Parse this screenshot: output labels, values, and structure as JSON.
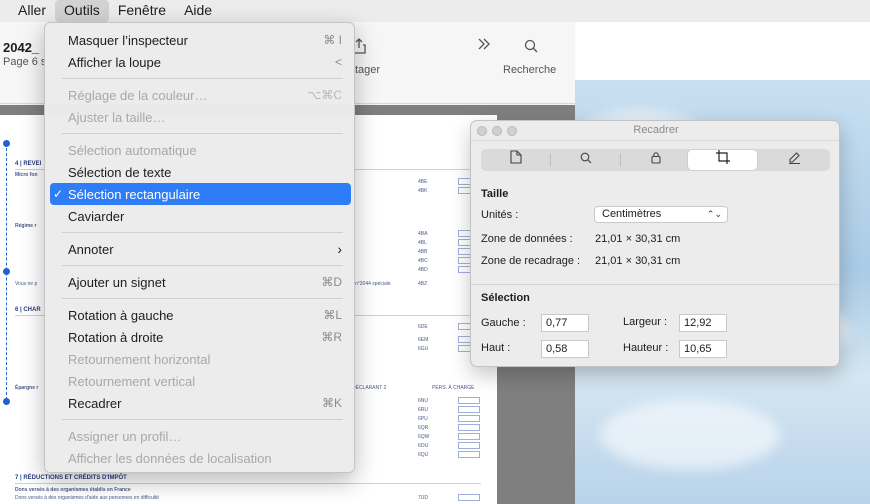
{
  "menubar": {
    "items": [
      "Aller",
      "Outils",
      "Fenêtre",
      "Aide"
    ],
    "active_index": 1
  },
  "preview": {
    "doc_title": "2042_",
    "doc_subtitle": "Page 6 s",
    "toolbar": {
      "share_label": "tager",
      "search_label": "Recherche"
    },
    "page_text": {
      "h4": "4 | REVEI",
      "h6": "6 | CHAR",
      "h7": "7 | RÉDUCTIONS ET CRÉDITS D'IMPÔT",
      "micro": "Micro fon",
      "regime": "Régime r",
      "epargne": "Épargne r",
      "dons1": "Dons versés à des organismes établis en France",
      "dons2": "Dons versés à des organismes d'aide aux personnes en difficulté",
      "vous_ne": "Vous ne p",
      "spec": "n°2044 spéciale",
      "codes": [
        "4BE",
        "4BK",
        "4BA",
        "4BL",
        "4BB",
        "4BC",
        "4BD",
        "4BZ",
        "6DE",
        "6EM",
        "6GU",
        "6NU",
        "6RU",
        "6PU",
        "6QR",
        "6QW",
        "6OU",
        "6QU",
        "7UD"
      ],
      "declarant": "DÉCLARANT 2",
      "pers": "PERS. À CHARGE"
    }
  },
  "menu": {
    "items": [
      {
        "label": "Masquer l’inspecteur",
        "shortcut": "⌘ I",
        "enabled": true
      },
      {
        "label": "Afficher la loupe",
        "shortcut": "<",
        "enabled": true
      },
      {
        "label": "Réglage de la couleur…",
        "shortcut": "⌥⌘C",
        "enabled": false
      },
      {
        "label": "Ajuster la taille…",
        "shortcut": "",
        "enabled": false
      },
      {
        "label": "Sélection automatique",
        "shortcut": "",
        "enabled": false
      },
      {
        "label": "Sélection de texte",
        "shortcut": "",
        "enabled": true
      },
      {
        "label": "Sélection rectangulaire",
        "shortcut": "",
        "enabled": true,
        "checked": true,
        "highlighted": true
      },
      {
        "label": "Caviarder",
        "shortcut": "",
        "enabled": true
      },
      {
        "label": "Annoter",
        "shortcut": "",
        "enabled": true,
        "submenu": true
      },
      {
        "label": "Ajouter un signet",
        "shortcut": "⌘D",
        "enabled": true
      },
      {
        "label": "Rotation à gauche",
        "shortcut": "⌘L",
        "enabled": true
      },
      {
        "label": "Rotation à droite",
        "shortcut": "⌘R",
        "enabled": true
      },
      {
        "label": "Retournement horizontal",
        "shortcut": "",
        "enabled": false
      },
      {
        "label": "Retournement vertical",
        "shortcut": "",
        "enabled": false
      },
      {
        "label": "Recadrer",
        "shortcut": "⌘K",
        "enabled": true
      },
      {
        "label": "Assigner un profil…",
        "shortcut": "",
        "enabled": false
      },
      {
        "label": "Afficher les données de localisation",
        "shortcut": "",
        "enabled": false
      }
    ]
  },
  "panel": {
    "title": "Recadrer",
    "tabs": [
      "document-icon",
      "search-icon",
      "lock-icon",
      "crop-icon",
      "pen-icon"
    ],
    "active_tab": 3,
    "taille": {
      "heading": "Taille",
      "units_label": "Unités :",
      "units_value": "Centimètres",
      "data_zone_label": "Zone de données :",
      "data_zone_value": "21,01 × 30,31 cm",
      "crop_zone_label": "Zone de recadrage :",
      "crop_zone_value": "21,01 × 30,31 cm"
    },
    "selection": {
      "heading": "Sélection",
      "left_label": "Gauche :",
      "left_value": "0,77",
      "top_label": "Haut :",
      "top_value": "0,58",
      "width_label": "Largeur :",
      "width_value": "12,92",
      "height_label": "Hauteur :",
      "height_value": "10,65"
    }
  },
  "colors": {
    "highlight": "#2e7cf6",
    "selection": "#1e63d0"
  }
}
